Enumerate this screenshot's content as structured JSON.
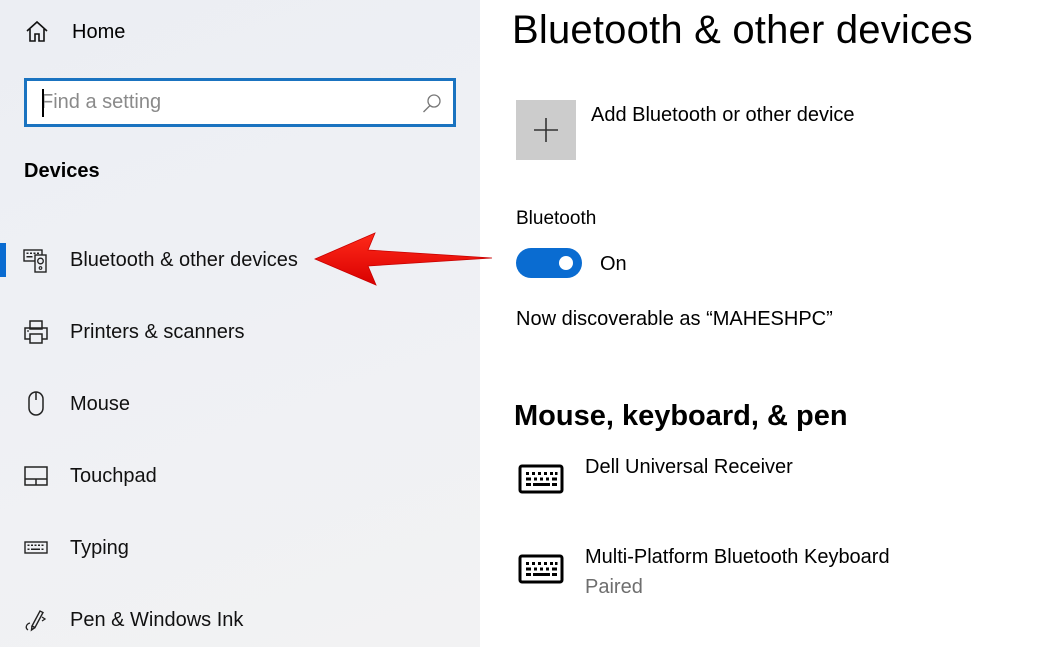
{
  "sidebar": {
    "home_label": "Home",
    "search": {
      "placeholder": "Find a setting",
      "value": ""
    },
    "section_title": "Devices",
    "items": [
      {
        "label": "Bluetooth & other devices",
        "icon": "bluetooth-devices-icon",
        "selected": true
      },
      {
        "label": "Printers & scanners",
        "icon": "printer-icon",
        "selected": false
      },
      {
        "label": "Mouse",
        "icon": "mouse-icon",
        "selected": false
      },
      {
        "label": "Touchpad",
        "icon": "touchpad-icon",
        "selected": false
      },
      {
        "label": "Typing",
        "icon": "keyboard-icon",
        "selected": false
      },
      {
        "label": "Pen & Windows Ink",
        "icon": "pen-icon",
        "selected": false
      }
    ]
  },
  "main": {
    "title": "Bluetooth & other devices",
    "add_device_label": "Add Bluetooth or other device",
    "bluetooth": {
      "label": "Bluetooth",
      "state": "On",
      "enabled": true,
      "discoverable_text": "Now discoverable as “MAHESHPC”"
    },
    "section_heading": "Mouse, keyboard, & pen",
    "devices": [
      {
        "name": "Dell Universal Receiver",
        "status": "",
        "icon": "keyboard-icon"
      },
      {
        "name": "Multi-Platform Bluetooth Keyboard",
        "status": "Paired",
        "icon": "keyboard-icon"
      }
    ]
  },
  "colors": {
    "accent": "#0a6cd1",
    "search_border": "#1a73c0",
    "add_tile": "#cccccc",
    "annotation_arrow": "#ee0a0a",
    "secondary_text": "#6e6e6e"
  },
  "annotation": {
    "type": "arrow",
    "points_to": "Bluetooth & other devices"
  }
}
